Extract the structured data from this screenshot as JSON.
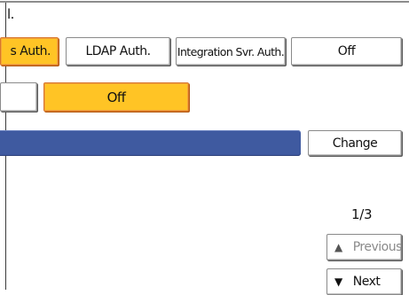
{
  "header": {
    "truncated_text": "l."
  },
  "auth_options": {
    "items": [
      {
        "label": "s Auth.",
        "selected": true
      },
      {
        "label": "LDAP Auth.",
        "selected": false
      },
      {
        "label": "Integration Svr. Auth.",
        "selected": false
      },
      {
        "label": "Off",
        "selected": false
      }
    ]
  },
  "setting_row": {
    "options": [
      {
        "label": "",
        "selected": false
      },
      {
        "label": "Off",
        "selected": true
      }
    ]
  },
  "list_row": {
    "change_label": "Change"
  },
  "pager": {
    "indicator": "1/3",
    "previous_label": "Previous",
    "next_label": "Next",
    "previous_icon": "triangle-up-icon",
    "next_icon": "triangle-down-icon"
  },
  "colors": {
    "selected_fill": "#ffc425",
    "selected_border": "#d8762a",
    "bar_blue": "#3f5aa0"
  }
}
